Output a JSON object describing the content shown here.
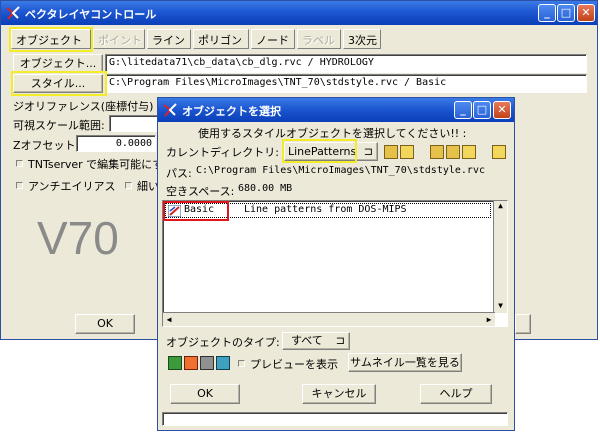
{
  "main_window": {
    "title": "ベクタレイヤコントロール",
    "tabs": [
      {
        "label": "オブジェクト",
        "enabled": true
      },
      {
        "label": "ポイント",
        "enabled": false
      },
      {
        "label": "ライン",
        "enabled": true
      },
      {
        "label": "ポリゴン",
        "enabled": true
      },
      {
        "label": "ノード",
        "enabled": true
      },
      {
        "label": "ラベル",
        "enabled": false
      },
      {
        "label": "3次元",
        "enabled": true
      }
    ],
    "object_button": "オブジェクト...",
    "object_path": "G:\\litedata71\\cb_data\\cb_dlg.rvc / HYDROLOGY",
    "style_button": "スタイル...",
    "style_path": "C:\\Program Files\\MicroImages\\TNT_70\\stdstyle.rvc / Basic",
    "georef_label": "ジオリファレンス(座標付与)",
    "visible_scale_label": "可視スケール範囲:",
    "z_offset_label": "Zオフセット:",
    "z_offset_value": "0.0000",
    "tntserver_label": "TNTserver で編集可能にす",
    "antialias_label": "アンチエイリアス",
    "thin_label": "細い",
    "watermark": "V70",
    "ok_label": "OK"
  },
  "dialog": {
    "title": "オブジェクトを選択",
    "prompt": "使用するスタイルオブジェクトを選択してください!! :",
    "current_dir_label": "カレントディレクトリ:",
    "current_dir_value": "LinePatterns",
    "path_label": "パス:",
    "path_value": "C:\\Program Files\\MicroImages\\TNT_70\\stdstyle.rvc",
    "free_space_label": "空きスペース:",
    "free_space_value": "680.00 MB",
    "list_items": [
      {
        "name": "Basic",
        "description": "Line patterns from DOS-MIPS"
      }
    ],
    "object_type_label": "オブジェクトのタイプ:",
    "object_type_value": "すべて",
    "preview_label": "プレビューを表示",
    "thumbnail_button": "サムネイル一覧を見る",
    "ok_label": "OK",
    "cancel_label": "キャンセル",
    "help_label": "ヘルプ"
  },
  "colors": {
    "highlight_yellow": "#f3ec2a",
    "highlight_red": "#e0151b",
    "titlebar_blue": "#1d57d1"
  }
}
